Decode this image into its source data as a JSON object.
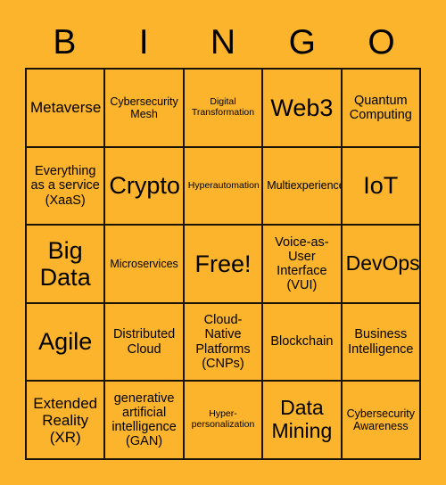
{
  "colors": {
    "background": "#FCB42C",
    "cell_background": "#FCB42C",
    "border": "#1a1408",
    "text": "#000000"
  },
  "header": {
    "letters": [
      "B",
      "I",
      "N",
      "G",
      "O"
    ]
  },
  "grid": {
    "columns": 5,
    "rows": 5,
    "free_space": "Free!",
    "cells": [
      {
        "text": "Metaverse",
        "size": "sz-l"
      },
      {
        "text": "Cybersecurity Mesh",
        "size": "sz-s"
      },
      {
        "text": "Digital Transformation",
        "size": "sz-xs"
      },
      {
        "text": "Web3",
        "size": "sz-xxl"
      },
      {
        "text": "Quantum Computing",
        "size": "sz-m"
      },
      {
        "text": "Everything as a service (XaaS)",
        "size": "sz-m"
      },
      {
        "text": "Crypto",
        "size": "sz-xxl"
      },
      {
        "text": "Hyperautomation",
        "size": "sz-xs"
      },
      {
        "text": "Multiexperience",
        "size": "sz-s"
      },
      {
        "text": "IoT",
        "size": "sz-xxl"
      },
      {
        "text": "Big Data",
        "size": "sz-xxl"
      },
      {
        "text": "Microservices",
        "size": "sz-s"
      },
      {
        "text": "Free!",
        "size": "sz-xxl"
      },
      {
        "text": "Voice-as-User Interface (VUI)",
        "size": "sz-m"
      },
      {
        "text": "DevOps",
        "size": "sz-xl"
      },
      {
        "text": "Agile",
        "size": "sz-xxl"
      },
      {
        "text": "Distributed Cloud",
        "size": "sz-m"
      },
      {
        "text": "Cloud-Native Platforms (CNPs)",
        "size": "sz-m"
      },
      {
        "text": "Blockchain",
        "size": "sz-m"
      },
      {
        "text": "Business Intelligence",
        "size": "sz-m"
      },
      {
        "text": "Extended Reality (XR)",
        "size": "sz-l"
      },
      {
        "text": "generative artificial intelligence (GAN)",
        "size": "sz-m"
      },
      {
        "text": "Hyper-personalization",
        "size": "sz-xs"
      },
      {
        "text": "Data Mining",
        "size": "sz-xl"
      },
      {
        "text": "Cybersecurity Awareness",
        "size": "sz-s"
      }
    ]
  }
}
